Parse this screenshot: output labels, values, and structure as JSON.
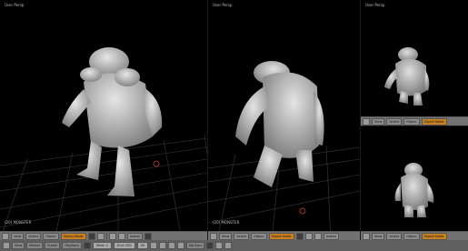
{
  "viewports": {
    "left": {
      "title": "User Persp",
      "object": "(20) MONSTER"
    },
    "middle": {
      "title": "User Persp",
      "object": "(20) MONSTER"
    },
    "top_right": {
      "title": "User Persp",
      "object": ""
    },
    "bottom_right": {
      "title": "",
      "object": ""
    }
  },
  "header": {
    "view": "View",
    "select": "Select",
    "object": "Object",
    "mode": "Object Mode",
    "pivot": "Global",
    "extra": "Layers"
  },
  "timeline": {
    "view": "View",
    "marker": "Marker",
    "frame": "Frame",
    "playback": "Playback",
    "start": "Start: 1",
    "end": "End: 250",
    "current": "20",
    "sync": "No Sync"
  },
  "colors": {
    "viewport_bg": "#000000",
    "grid": "#3c3c3c",
    "header": "#727272",
    "mode_button": "#c98020",
    "model": "#c9c9c9"
  }
}
